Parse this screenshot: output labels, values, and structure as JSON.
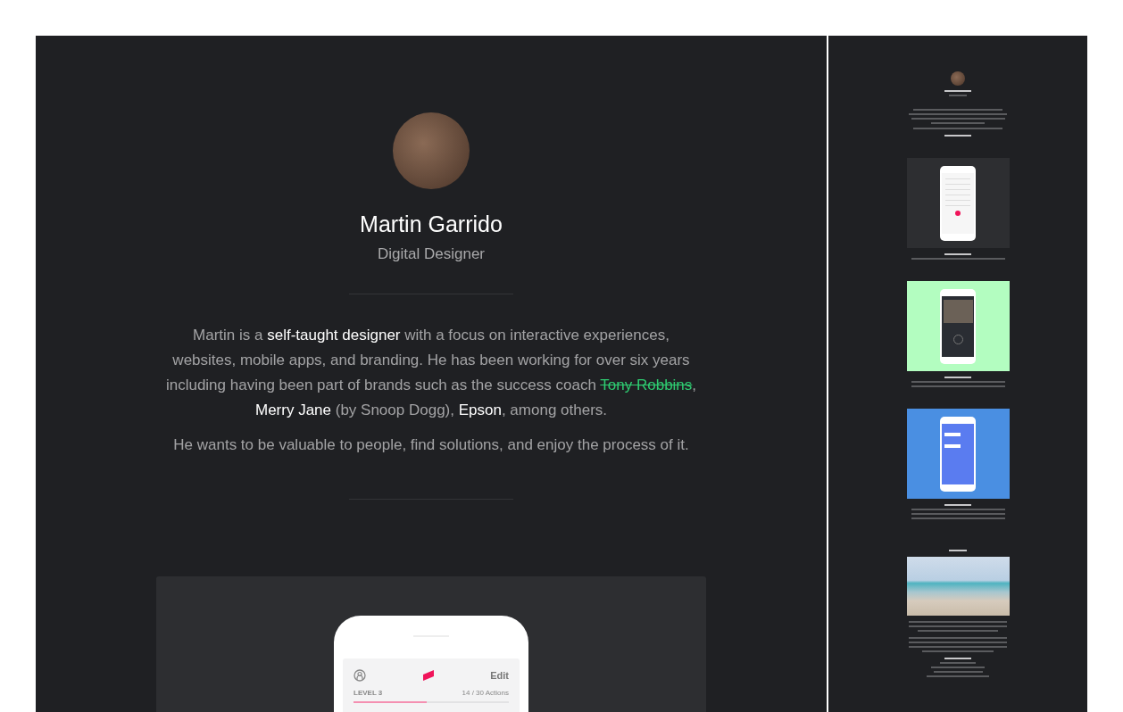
{
  "profile": {
    "name": "Martin Garrido",
    "role": "Digital Designer"
  },
  "bio": {
    "before": "Martin is a **self-taught designer** with a focus on interactive experiences, websites, mobile apps, and branding. He has been working for over six years including having been part of brands such as the success coach ",
    "link": "Tony Robbins",
    "after": ", **Merry Jane** (by Snoop Dogg), **Epson**, among others."
  },
  "bio_2": "He wants to be valuable to people, find solutions, and enjoy the process of it.",
  "showcase": {
    "edit": "Edit",
    "level_label": "LEVEL 3",
    "actions": "14 / 30 Actions",
    "level": 0.47
  }
}
